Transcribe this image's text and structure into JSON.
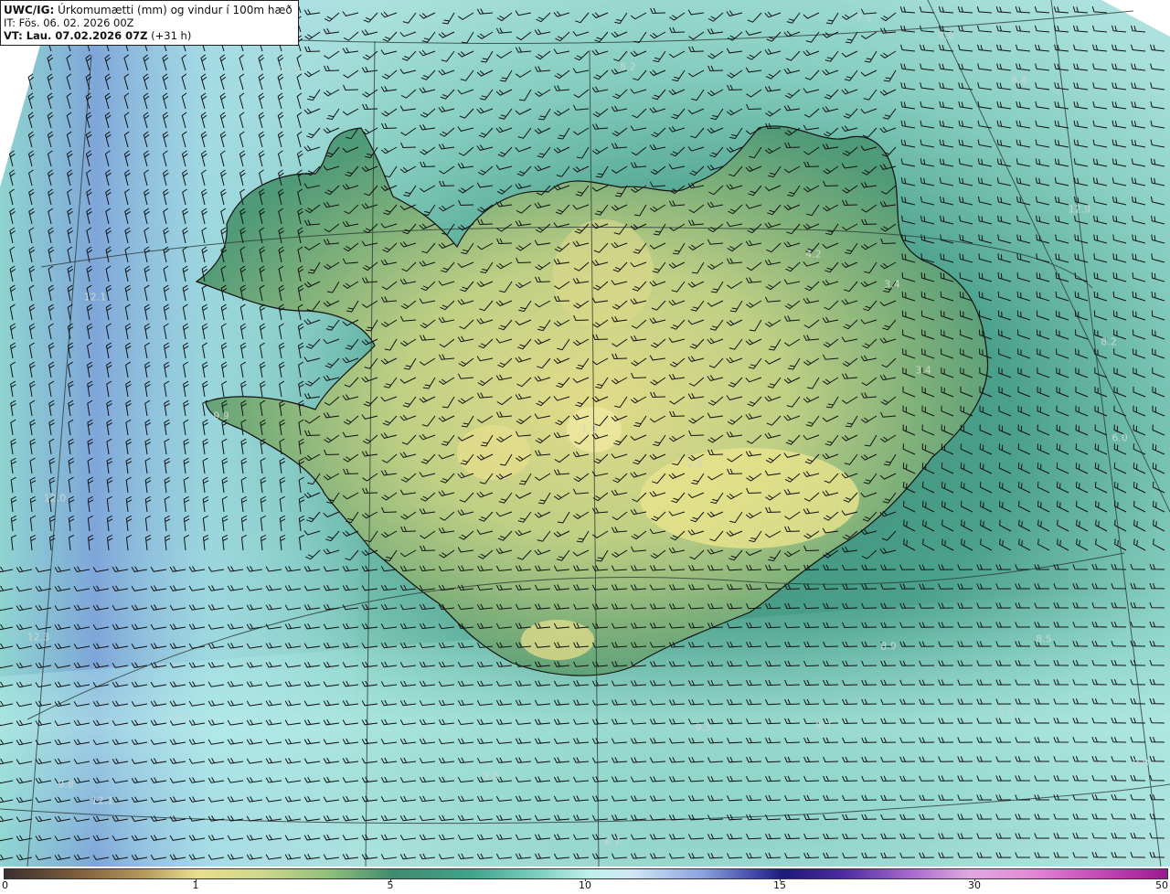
{
  "header": {
    "model": "UWC/IG:",
    "title": "Úrkomumætti (mm) og vindur í 100m hæð",
    "it_line": "IT: Fös. 06. 02. 2026 00Z",
    "vt_prefix": "VT: Lau. 07.02.2026 07Z",
    "vt_suffix": "(+31 h)"
  },
  "colorbar": {
    "ticks": [
      "0",
      "1",
      "5",
      "10",
      "15",
      "30",
      "50"
    ],
    "colors": {
      "low": "#7a5c3b",
      "one": "#e8df8a",
      "five": "#3f8a6e",
      "ten": "#bff0ec",
      "fifteen": "#1b1b78",
      "thirty": "#e58bd6",
      "fifty": "#9a1a8f"
    }
  },
  "map": {
    "region": "Iceland",
    "value_labels": [
      "7.5",
      "8.0",
      "11.9",
      "8.2",
      "8.4",
      "4.2",
      "3.4",
      "8.2",
      "3.4",
      "12.1",
      "6.0",
      "9.9",
      "1.0",
      "2.8",
      "12.0",
      "12.3",
      "9.8",
      "12.1",
      "10.2",
      "9.6",
      "9.3",
      "8.7",
      "5.9",
      "8.5",
      "8.9",
      "6.7",
      "9.8",
      "12.9"
    ]
  }
}
